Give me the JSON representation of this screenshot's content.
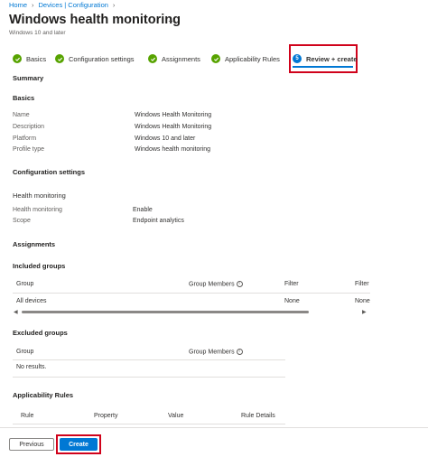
{
  "breadcrumb": [
    "Home",
    "Devices | Configuration"
  ],
  "header": {
    "title": "Windows health monitoring",
    "more": "...",
    "subtitle": "Windows 10 and later"
  },
  "steps": [
    {
      "label": "Basics",
      "state": "done"
    },
    {
      "label": "Configuration settings",
      "state": "done"
    },
    {
      "label": "Assignments",
      "state": "done"
    },
    {
      "label": "Applicability Rules",
      "state": "done"
    },
    {
      "label": "Review + create",
      "number": "5",
      "state": "active"
    }
  ],
  "summary": {
    "heading": "Summary",
    "basics": {
      "heading": "Basics",
      "rows": [
        {
          "label": "Name",
          "value": "Windows Health Monitoring"
        },
        {
          "label": "Description",
          "value": "Windows Health Monitoring"
        },
        {
          "label": "Platform",
          "value": "Windows 10 and later"
        },
        {
          "label": "Profile type",
          "value": "Windows health monitoring"
        }
      ]
    },
    "config": {
      "heading": "Configuration settings",
      "subheading": "Health monitoring",
      "rows": [
        {
          "label": "Health monitoring",
          "value": "Enable"
        },
        {
          "label": "Scope",
          "value": "Endpoint analytics"
        }
      ]
    },
    "assignments": {
      "heading": "Assignments",
      "included": {
        "heading": "Included groups",
        "columns": [
          "Group",
          "Group Members",
          "Filter",
          "Filter"
        ],
        "rows": [
          [
            "All devices",
            "",
            "None",
            "None"
          ]
        ]
      },
      "excluded": {
        "heading": "Excluded groups",
        "columns": [
          "Group",
          "Group Members"
        ],
        "empty": "No results."
      }
    },
    "applicability": {
      "heading": "Applicability Rules",
      "columns": [
        "Rule",
        "Property",
        "Value",
        "Rule Details"
      ]
    }
  },
  "footer": {
    "previous_label": "Previous",
    "create_label": "Create"
  },
  "colors": {
    "accent": "#0078d4",
    "success": "#57a300",
    "highlight": "#d0021b"
  }
}
